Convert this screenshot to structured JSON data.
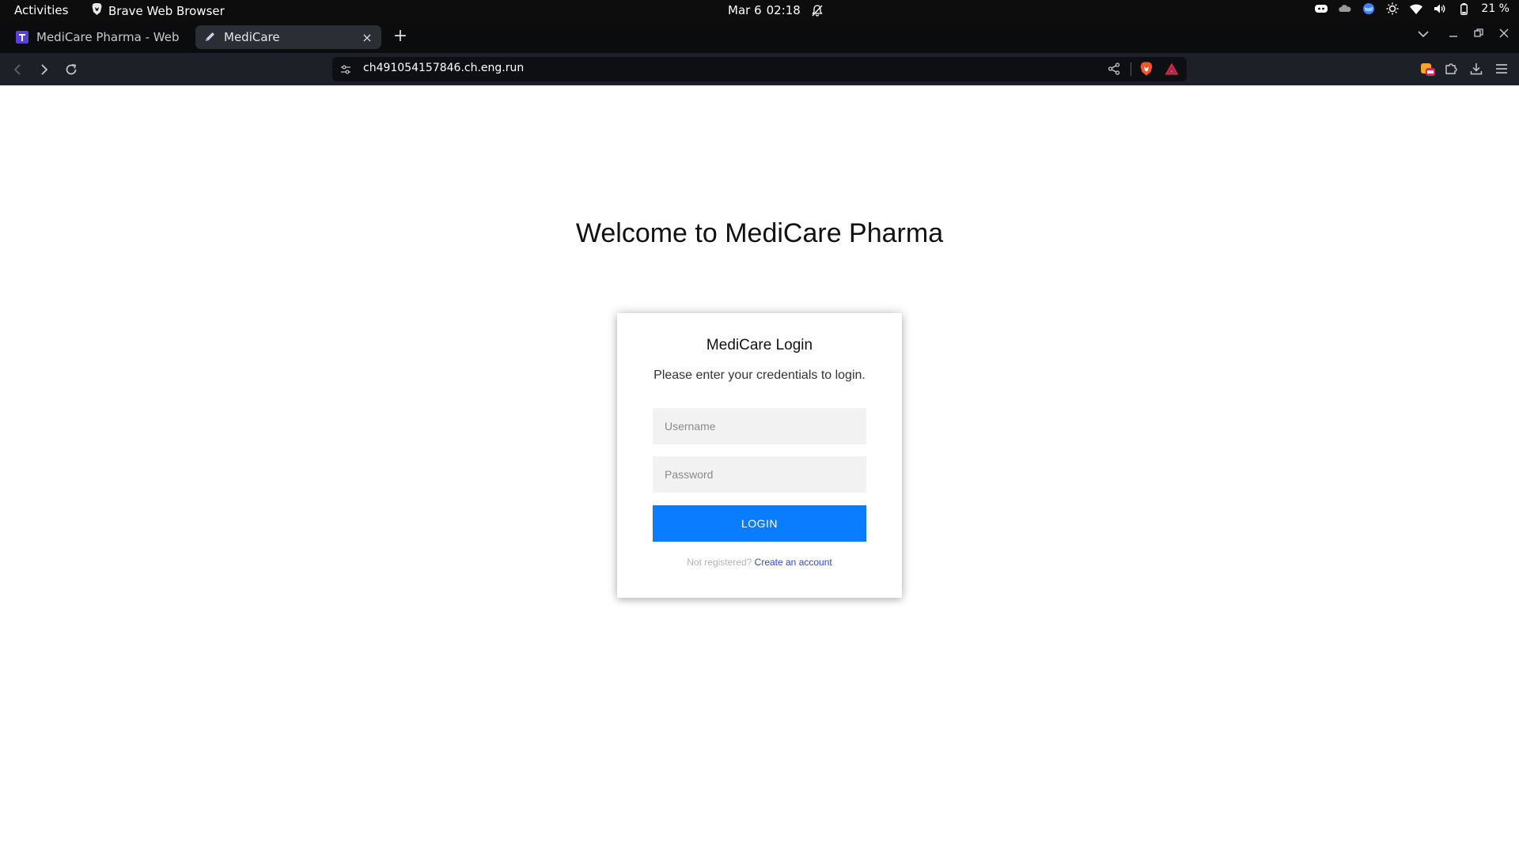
{
  "system_bar": {
    "activities": "Activities",
    "app_name": "Brave Web Browser",
    "date": "Mar 6",
    "time": "02:18",
    "battery": "21 %"
  },
  "tabs": [
    {
      "label": "MediCare Pharma - Web Cha",
      "favicon": "T-purple-icon",
      "active": false
    },
    {
      "label": "MediCare",
      "favicon": "pen-icon",
      "active": true,
      "close": "×"
    }
  ],
  "new_tab_label": "+",
  "address_bar": {
    "url": "ch491054157846.ch.eng.run"
  },
  "page": {
    "heading": "Welcome to MediCare Pharma",
    "login_card": {
      "title": "MediCare Login",
      "subtitle": "Please enter your credentials to login.",
      "username_placeholder": "Username",
      "username_value": "",
      "password_placeholder": "Password",
      "password_value": "",
      "login_button": "LOGIN",
      "not_registered": "Not registered?",
      "create_account": "Create an account"
    }
  },
  "colors": {
    "login_button": "#0a7cff",
    "link": "#2b46d8",
    "topbar": "#0d0d0d",
    "toolbar": "#1e2027"
  }
}
